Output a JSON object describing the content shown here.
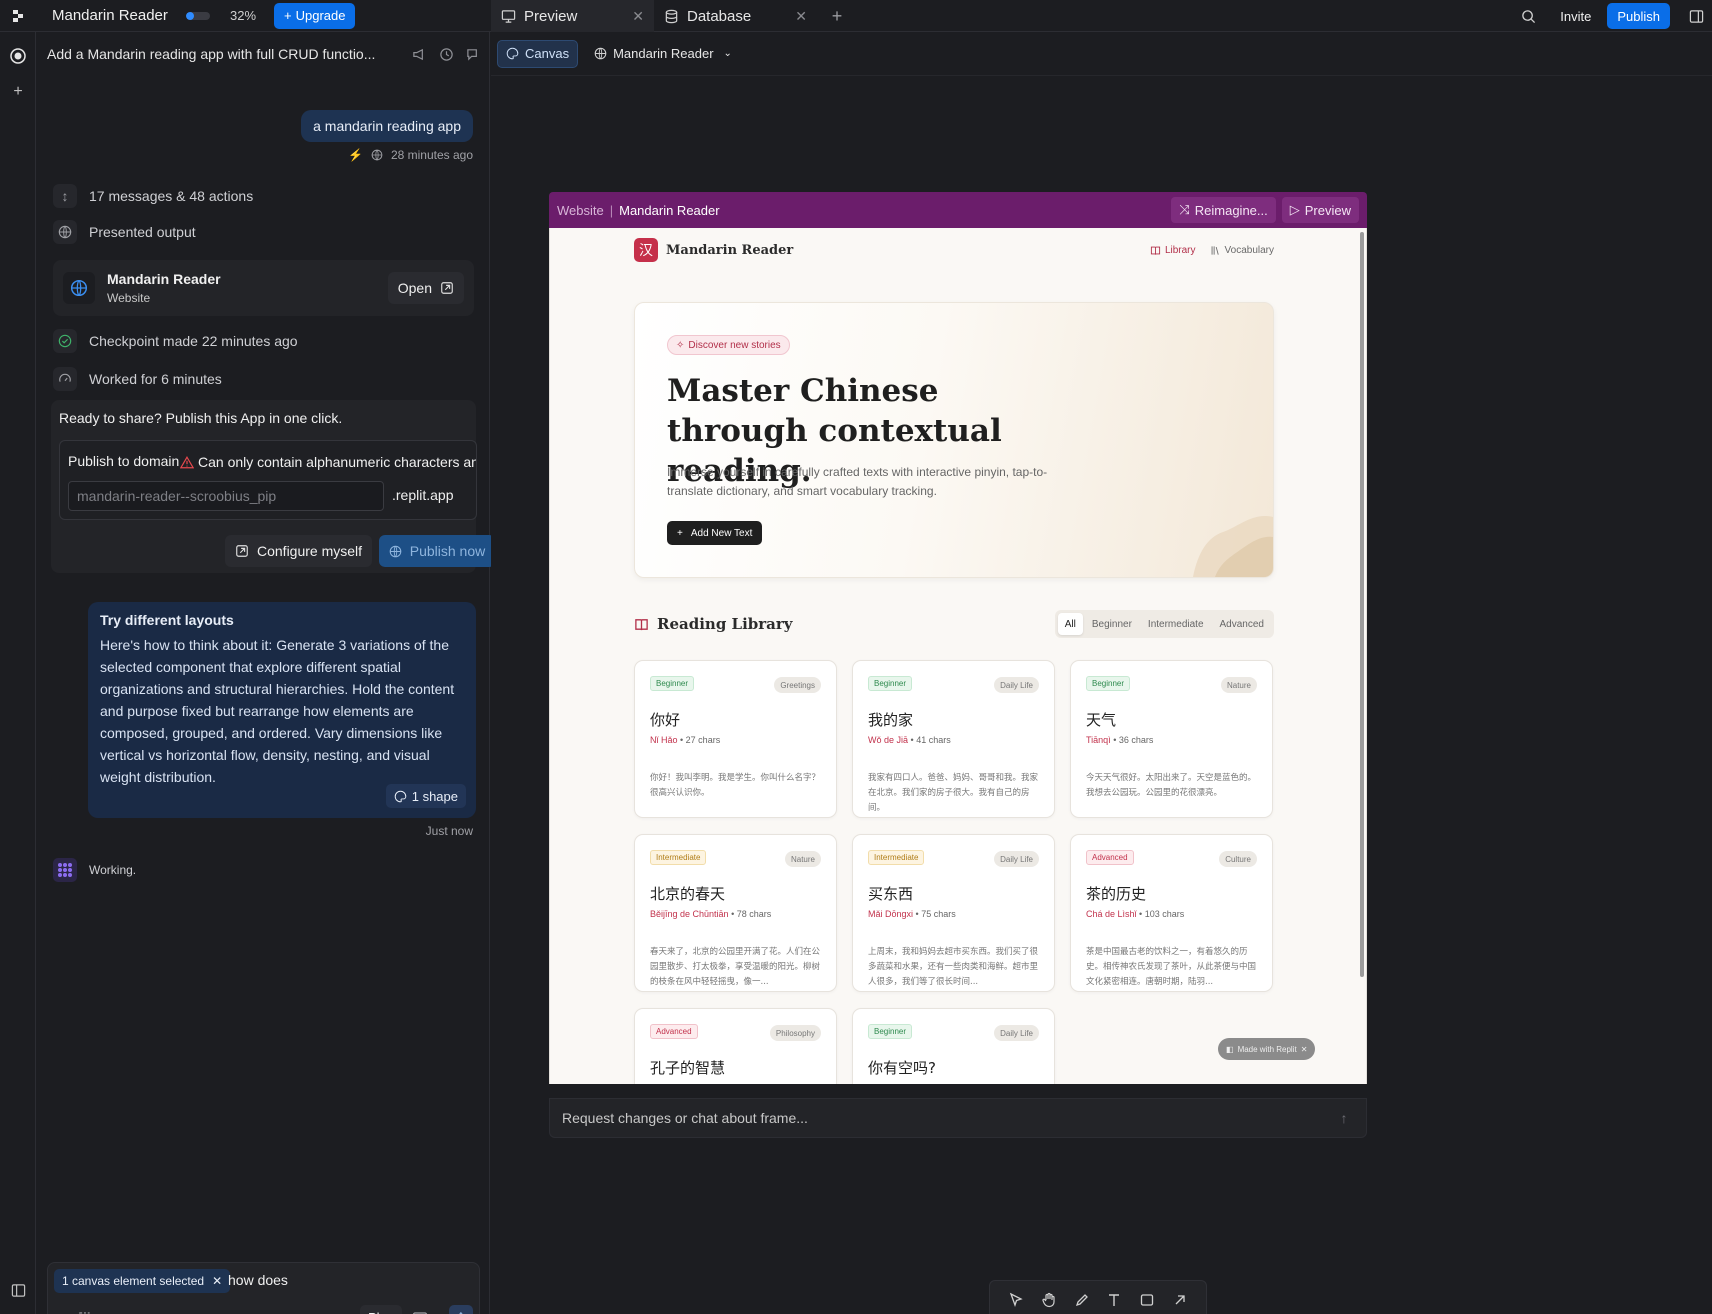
{
  "topbar": {
    "app_title": "Mandarin Reader",
    "progress_fraction": 0.32,
    "progress_pct": "32%",
    "upgrade_label": "Upgrade",
    "tabs": [
      {
        "label": "Preview"
      },
      {
        "label": "Database"
      }
    ],
    "invite_label": "Invite",
    "publish_label": "Publish"
  },
  "chat": {
    "header_title": "Add a Mandarin reading app with full CRUD functio...",
    "user_message": "a mandarin reading app",
    "user_message_time": "28 minutes ago",
    "summary_rows": {
      "messages": "17 messages & 48 actions",
      "presented": "Presented output",
      "checkpoint": "Checkpoint made 22 minutes ago",
      "worked": "Worked for 6 minutes"
    },
    "output_card": {
      "title": "Mandarin Reader",
      "subtitle": "Website",
      "open_label": "Open"
    },
    "publish": {
      "prompt": "Ready to share? Publish this App in one click.",
      "domain_label": "Publish to domain",
      "warning": "Can only contain alphanumeric characters and",
      "domain_value": "mandarin-reader--scroobius_pip",
      "suffix": ".replit.app",
      "configure_label": "Configure myself",
      "publish_now_label": "Publish now"
    },
    "layouts_card": {
      "title": "Try different layouts",
      "body": "Here's how to think about it: Generate 3 variations of the selected component that explore different spatial organizations and structural hierarchies. Hold the content and purpose fixed but rearrange how elements are composed, grouped, and ordered. Vary dimensions like vertical vs horizontal flow, density, nesting, and visual weight distribution.",
      "chip_label": "1 shape",
      "time": "Just now"
    },
    "working_label": "Working.",
    "composer": {
      "selection_chip": "1 canvas element selected",
      "text": "how does",
      "plan_label": "Plan"
    }
  },
  "canvas": {
    "canvas_btn": "Canvas",
    "site_selector": "Mandarin Reader",
    "frame_header": {
      "crumb1": "Website",
      "crumb2": "Mandarin Reader",
      "reimagine_label": "Reimagine...",
      "preview_label": "Preview"
    },
    "frame_input_placeholder": "Request changes or chat about frame..."
  },
  "site": {
    "logo_char": "汉",
    "name": "Mandarin Reader",
    "nav": {
      "library": "Library",
      "vocabulary": "Vocabulary"
    },
    "hero": {
      "chip": "Discover new stories",
      "title": "Master Chinese through contextual reading.",
      "subtitle": "Immerse yourself in carefully crafted texts with interactive pinyin, tap-to-translate dictionary, and smart vocabulary tracking.",
      "button": "Add New Text"
    },
    "library_title": "Reading Library",
    "filters": [
      "All",
      "Beginner",
      "Intermediate",
      "Advanced"
    ],
    "cards": [
      {
        "level": "Beginner",
        "category": "Greetings",
        "title": "你好",
        "pinyin": "Nǐ Hǎo",
        "chars": "27 chars",
        "body": "你好！我叫李明。我是学生。你叫什么名字？很高兴认识你。"
      },
      {
        "level": "Beginner",
        "category": "Daily Life",
        "title": "我的家",
        "pinyin": "Wǒ de Jiā",
        "chars": "41 chars",
        "body": "我家有四口人。爸爸、妈妈、哥哥和我。我家在北京。我们家的房子很大。我有自己的房间。"
      },
      {
        "level": "Beginner",
        "category": "Nature",
        "title": "天气",
        "pinyin": "Tiānqì",
        "chars": "36 chars",
        "body": "今天天气很好。太阳出来了。天空是蓝色的。我想去公园玩。公园里的花很漂亮。"
      },
      {
        "level": "Intermediate",
        "category": "Nature",
        "title": "北京的春天",
        "pinyin": "Běijīng de Chūntiān",
        "chars": "78 chars",
        "body": "春天来了，北京的公园里开满了花。人们在公园里散步、打太极拳，享受温暖的阳光。柳树的枝条在风中轻轻摇曳，像一..."
      },
      {
        "level": "Intermediate",
        "category": "Daily Life",
        "title": "买东西",
        "pinyin": "Mǎi Dōngxi",
        "chars": "75 chars",
        "body": "上周末，我和妈妈去超市买东西。我们买了很多蔬菜和水果，还有一些肉类和海鲜。超市里人很多，我们等了很长时间..."
      },
      {
        "level": "Advanced",
        "category": "Culture",
        "title": "茶的历史",
        "pinyin": "Chá de Lìshǐ",
        "chars": "103 chars",
        "body": "茶是中国最古老的饮料之一，有着悠久的历史。相传神农氏发现了茶叶，从此茶便与中国文化紧密相连。唐朝时期，陆羽..."
      },
      {
        "level": "Advanced",
        "category": "Philosophy",
        "title": "孔子的智慧",
        "pinyin": "",
        "chars": "",
        "body": ""
      },
      {
        "level": "Beginner",
        "category": "Daily Life",
        "title": "你有空吗?",
        "pinyin": "",
        "chars": "",
        "body": ""
      }
    ],
    "made_with": "Made with Replit"
  },
  "colors": {
    "accent_blue": "#0a6ee8",
    "frame_purple": "#6b1d6b",
    "site_red": "#c5304a"
  }
}
